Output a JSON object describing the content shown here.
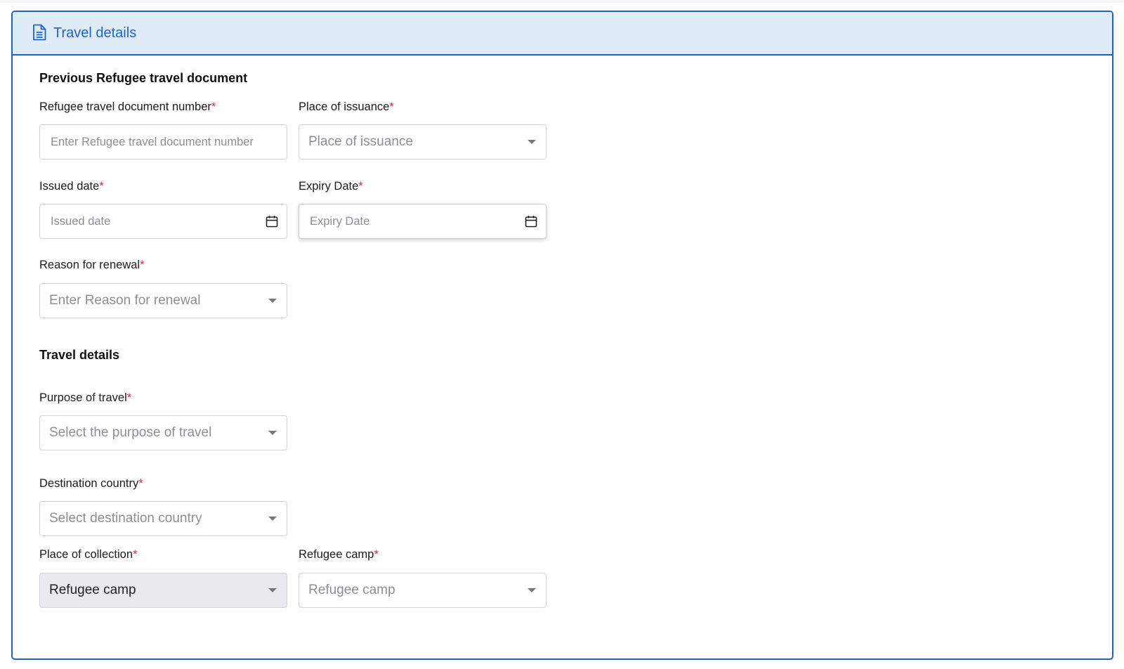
{
  "header": {
    "title": "Travel details",
    "icon": "document-icon"
  },
  "sections": {
    "previous": {
      "title": "Previous Refugee travel document"
    },
    "travel": {
      "title": "Travel details"
    }
  },
  "fields": {
    "doc_number": {
      "label": "Refugee travel document number",
      "placeholder": "Enter Refugee travel document number"
    },
    "place_issuance": {
      "label": "Place of issuance",
      "placeholder": "Place of issuance"
    },
    "issued_date": {
      "label": "Issued date",
      "placeholder": "Issued date"
    },
    "expiry_date": {
      "label": "Expiry Date",
      "placeholder": "Expiry Date"
    },
    "reason_renewal": {
      "label": "Reason for renewal",
      "placeholder": "Enter Reason for renewal"
    },
    "purpose_travel": {
      "label": "Purpose of travel",
      "placeholder": "Select the purpose of travel"
    },
    "destination_country": {
      "label": "Destination country",
      "placeholder": "Select destination country"
    },
    "place_collection": {
      "label": "Place of collection",
      "value": "Refugee camp"
    },
    "refugee_camp": {
      "label": "Refugee camp",
      "placeholder": "Refugee camp"
    }
  },
  "required_marker": "*",
  "colors": {
    "accent": "#1e64c8",
    "header_bg": "#dfecf8",
    "required": "#e0243a"
  }
}
